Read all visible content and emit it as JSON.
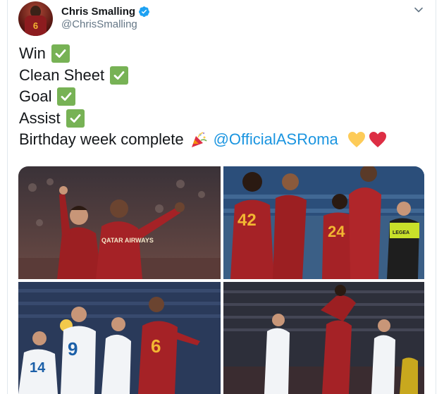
{
  "tweet": {
    "author": {
      "display_name": "Chris Smalling",
      "handle": "@ChrisSmalling",
      "avatar_jersey_number": "6",
      "verified": true
    },
    "lines": [
      {
        "text": "Win",
        "emoji": "check-mark-button"
      },
      {
        "text": "Clean Sheet",
        "emoji": "check-mark-button"
      },
      {
        "text": "Goal",
        "emoji": "check-mark-button"
      },
      {
        "text": "Assist",
        "emoji": "check-mark-button"
      }
    ],
    "last_line": {
      "text": "Birthday week complete",
      "mention": "@OfficialASRoma",
      "emojis": [
        "party-popper",
        "yellow-heart",
        "red-heart"
      ]
    },
    "photos": [
      {
        "jersey_text": "QATAR AIRWAYS"
      },
      {
        "jersey_numbers": [
          "42",
          "24"
        ],
        "ref_badge": "LEGEA"
      },
      {
        "jersey_numbers": [
          "9",
          "14",
          "6"
        ]
      },
      {
        "jersey_numbers": []
      }
    ]
  },
  "colors": {
    "text": "#14171a",
    "secondary": "#657786",
    "link": "#1b95e0",
    "verified": "#1da1f2",
    "check_emoji": "#77b255",
    "roma_red": "#8d1c1f",
    "roma_gold": "#f2b632"
  },
  "icons": {
    "verified": "verified-badge-icon",
    "caret": "chevron-down-icon"
  }
}
